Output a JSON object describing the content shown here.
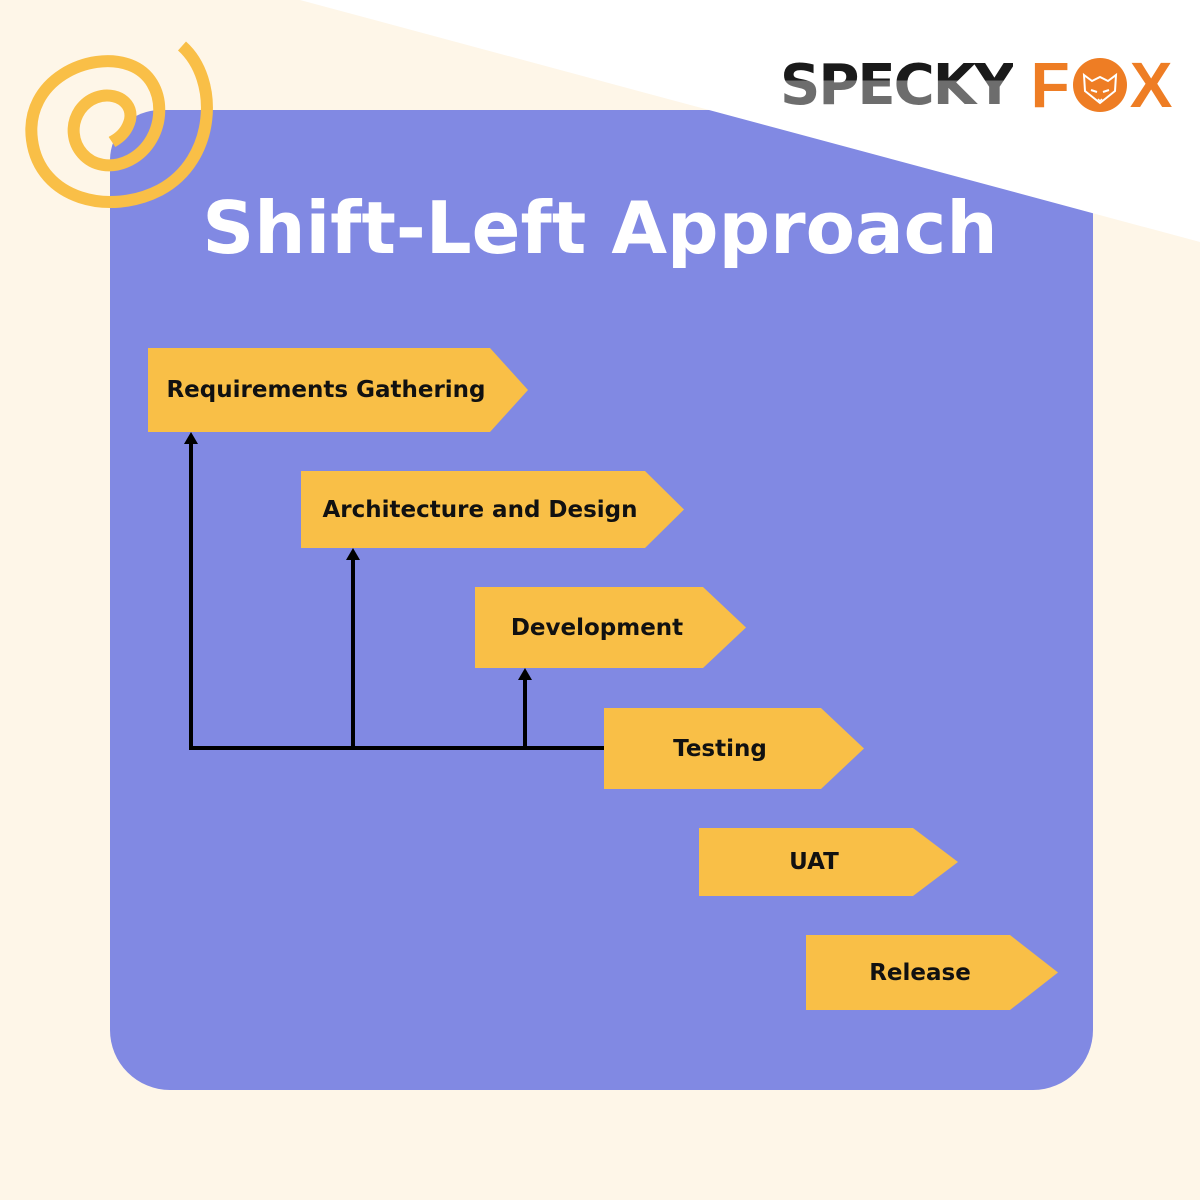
{
  "title": "Shift-Left Approach",
  "logo": {
    "word1": "SPECKY",
    "word2_prefix": "F",
    "word2_suffix": "X",
    "icon": "fox-face-icon"
  },
  "colors": {
    "background": "#FEF6E8",
    "panel": "#8189E3",
    "step_fill": "#F9BF47",
    "accent_orange": "#EE7D24",
    "spiral": "#F9BF47",
    "connector": "#000000",
    "title_text": "#FFFFFF"
  },
  "steps": [
    {
      "label": "Requirements Gathering"
    },
    {
      "label": "Architecture and Design"
    },
    {
      "label": "Development"
    },
    {
      "label": "Testing"
    },
    {
      "label": "UAT"
    },
    {
      "label": "Release"
    }
  ],
  "connectors": {
    "source_step": "Testing",
    "targets": [
      "Requirements Gathering",
      "Architecture and Design",
      "Development"
    ]
  }
}
